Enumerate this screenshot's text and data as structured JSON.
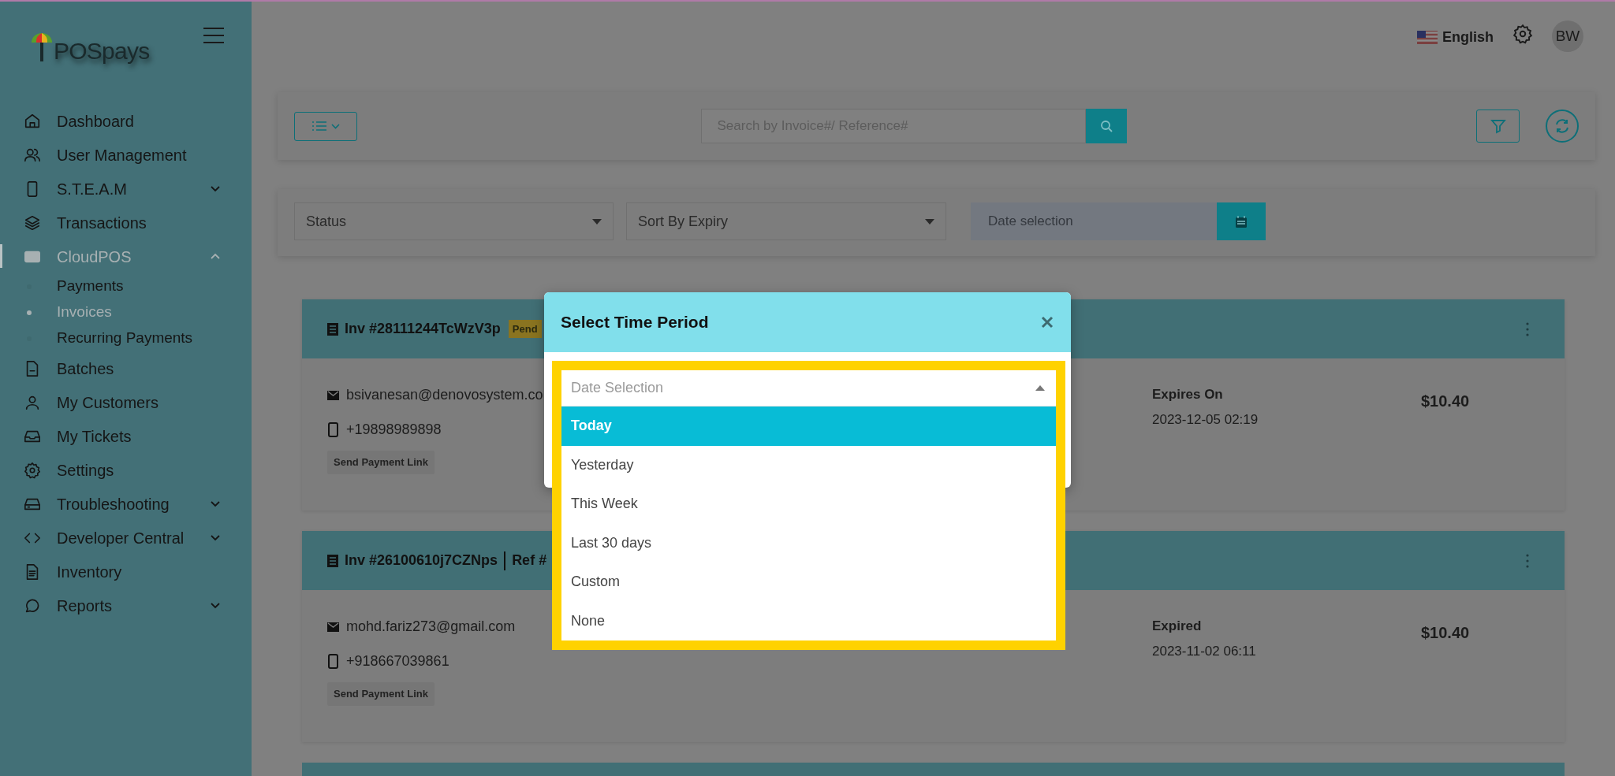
{
  "sidebar": {
    "logo": "POSpays",
    "items": [
      {
        "label": "Dashboard",
        "selected": false
      },
      {
        "label": "User Management",
        "selected": false
      },
      {
        "label": "S.T.E.A.M",
        "selected": false,
        "expanded": false
      },
      {
        "label": "Transactions",
        "selected": false
      },
      {
        "label": "CloudPOS",
        "selected": true,
        "expanded": true,
        "children": [
          {
            "label": "Payments",
            "selected": false
          },
          {
            "label": "Invoices",
            "selected": true
          },
          {
            "label": "Recurring Payments",
            "selected": false
          }
        ]
      },
      {
        "label": "Batches",
        "selected": false
      },
      {
        "label": "My Customers",
        "selected": false
      },
      {
        "label": "My Tickets",
        "selected": false
      },
      {
        "label": "Settings",
        "selected": false
      },
      {
        "label": "Troubleshooting",
        "selected": false,
        "expanded": false
      },
      {
        "label": "Developer Central",
        "selected": false,
        "expanded": false
      },
      {
        "label": "Inventory",
        "selected": false
      },
      {
        "label": "Reports",
        "selected": false,
        "expanded": false
      }
    ]
  },
  "top_bar": {
    "language": "English",
    "avatar": "BW"
  },
  "toolbar": {
    "search": {
      "placeholder": "Search by Invoice#/ Reference#"
    }
  },
  "filters": {
    "status_select": {
      "value": "Status"
    },
    "sort_select": {
      "value": "Sort By Expiry"
    },
    "date_field": {
      "placeholder": "Date selection"
    }
  },
  "invoices": [
    {
      "kind": "full",
      "title": "Inv #28111244TcWzV3p",
      "badge": "Pend",
      "email": "bsivanesan@denovosystem.co",
      "phone": "+19898989898",
      "action": "Send Payment Link",
      "date_label": "Expires On",
      "date": "2023-12-05 02:19",
      "amount": "$10.40"
    },
    {
      "kind": "full",
      "title": "Inv #26100610j7CZNps",
      "reference": "Ref #",
      "email": "mohd.fariz273@gmail.com",
      "phone": "+918667039861",
      "action": "Send Payment Link",
      "date_label": "Expired",
      "date": "2023-11-02 06:11",
      "amount": "$10.40"
    },
    {
      "kind": "collapsed"
    }
  ],
  "modal": {
    "title": "Select Time Period",
    "select": {
      "placeholder": "Date Selection",
      "expanded": true
    },
    "options": [
      {
        "label": "Today",
        "selected": true
      },
      {
        "label": "Yesterday",
        "selected": false
      },
      {
        "label": "This Week",
        "selected": false
      },
      {
        "label": "Last 30 days",
        "selected": false
      },
      {
        "label": "Custom",
        "selected": false
      },
      {
        "label": "None",
        "selected": false
      }
    ]
  }
}
